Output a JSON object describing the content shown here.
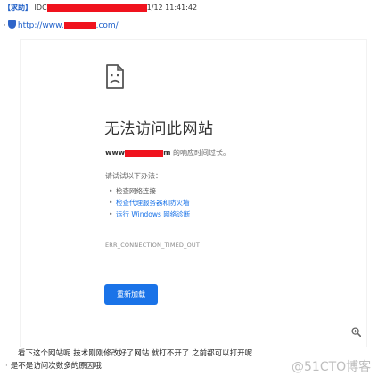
{
  "header": {
    "tag": "【求助】",
    "prefix": "IDC",
    "date_suffix": "1/12 11:41:42"
  },
  "link": {
    "prefix": "http://www.",
    "suffix": ".com/"
  },
  "error_page": {
    "title": "无法访问此网站",
    "host_prefix": "www",
    "host_suffix": "m",
    "description": " 的响应时间过长。",
    "try_label": "请试试以下办法：",
    "tips": [
      "检查网络连接",
      "检查代理服务器和防火墙",
      "运行 Windows 网络诊断"
    ],
    "error_code": "ERR_CONNECTION_TIMED_OUT",
    "reload_label": "重新加载"
  },
  "question": {
    "line1": "看下这个网站呢 技术刚刚修改好了网站 就打不开了 之前都可以打开呢",
    "line2": "是不是访问次数多的原因哦"
  },
  "watermark": "@51CTO博客",
  "colors": {
    "redaction": "#f0131e",
    "link": "#1a73e8",
    "button": "#1a73e8"
  },
  "icons": {
    "error_icon": "sad-document-icon",
    "zoom_icon": "magnifier-zoom-icon",
    "site_icon": "shield-icon"
  }
}
